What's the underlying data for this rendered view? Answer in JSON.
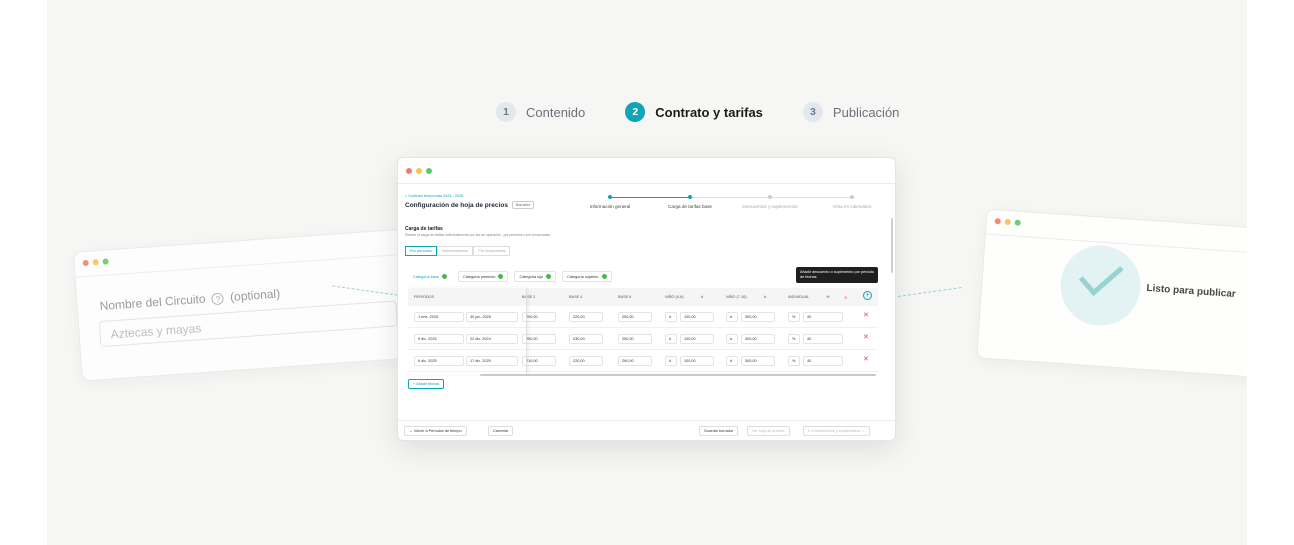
{
  "steps": [
    {
      "num": "1",
      "label": "Contenido"
    },
    {
      "num": "2",
      "label": "Contrato  y tarifas"
    },
    {
      "num": "3",
      "label": "Publicación"
    }
  ],
  "left_card": {
    "label": "Nombre del Circuito",
    "help": "?",
    "optional": "(optional)",
    "input_value": "Aztecas y mayas"
  },
  "right_card": {
    "ready_text": "Listo para publicar"
  },
  "window": {
    "breadcrumb": "< Contrato temporada 2024 - 2025",
    "title": "Configuración de hoja de precios",
    "badge": "Borrador",
    "wizard": [
      {
        "label": "Información general",
        "done": true
      },
      {
        "label": "Carga de tarifas base",
        "done": true
      },
      {
        "label": "Descuentos y suplementos",
        "done": false
      },
      {
        "label": "Vista en calendario",
        "done": false
      }
    ],
    "section_title": "Carga de tarifas",
    "section_desc": "Realice la carga de tarifas individualmente por día de operación , por períodos o por temporadas",
    "modes": [
      "Por períodos",
      "Individualmente",
      "Por temporadas"
    ],
    "categories": [
      {
        "label": "Categoría base",
        "active": true
      },
      {
        "label": "Categoría premium",
        "active": false
      },
      {
        "label": "Categoría lujo",
        "active": false
      },
      {
        "label": "Categoría superior",
        "active": false
      }
    ],
    "tooltip": "Añadir descuento o suplemento por período de fechas",
    "add_icon": "+",
    "table": {
      "headers": {
        "periodos": "PERIODOS",
        "base2": "BASE 2",
        "base4": "BASE 4",
        "base6": "BASE 6",
        "nino1": "NIÑO (0-6)",
        "nino2": "NIÑO (7-16)",
        "individual": "INDIVIDUAL",
        "unit": "%",
        "curr": "#",
        "del": "✕"
      },
      "rows": [
        {
          "from": "1 ene. 2025",
          "to": "30 jun. 2025",
          "base2": "200,00",
          "base4": "220,00",
          "base6": "250,00",
          "n1_unit": "#",
          "n1": "100,00",
          "n2_unit": "#",
          "n2": "300,00",
          "ind_unit": "%",
          "ind": "40"
        },
        {
          "from": "9 dic. 2025",
          "to": "22 dic. 2024",
          "base2": "250,00",
          "base4": "230,00",
          "base6": "250,00",
          "n1_unit": "#",
          "n1": "100,00",
          "n2_unit": "#",
          "n2": "300,00",
          "ind_unit": "%",
          "ind": "40"
        },
        {
          "from": "6 dic. 2025",
          "to": "17 dic. 2025",
          "base2": "210,00",
          "base4": "220,00",
          "base6": "260,00",
          "n1_unit": "#",
          "n1": "100,00",
          "n2_unit": "#",
          "n2": "300,00",
          "ind_unit": "%",
          "ind": "40"
        }
      ],
      "delete_glyph": "✕",
      "calendar_glyph": "▭"
    },
    "add_dates": "+ Añadir fechas",
    "footer": {
      "back": "← Volver a Períodos de tiempo",
      "cancel": "Cancelar",
      "save": "Guardar borrador",
      "view": "Ver hoja de precios",
      "next": "Ir a Descuentos y suplementos →"
    }
  },
  "colors": {
    "accent": "#0ea5b5",
    "ok": "#4cb553",
    "danger": "#e34a4a",
    "background": "#f6f6f4"
  }
}
